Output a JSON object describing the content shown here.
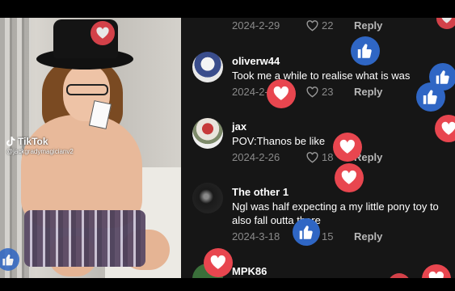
{
  "video": {
    "platform": "TikTok",
    "username": "@jackgradymagicianv2"
  },
  "comments": [
    {
      "name": "",
      "text": "",
      "date": "2024-2-29",
      "likes": "22",
      "reply": "Reply"
    },
    {
      "name": "oliverw44",
      "text": "Took me a while to realise what is was",
      "date": "2024-2-29",
      "likes": "23",
      "reply": "Reply"
    },
    {
      "name": "jax",
      "text": "POV:Thanos be like",
      "date": "2024-2-26",
      "likes": "18",
      "reply": "Reply"
    },
    {
      "name": "The other 1",
      "text": "Ngl was half expecting a my little pony toy to also fall outta there",
      "date": "2024-3-18",
      "likes": "15",
      "reply": "Reply"
    },
    {
      "name": "MPK86",
      "text": "",
      "date": "",
      "likes": "",
      "reply": ""
    }
  ],
  "colors": {
    "heart_reaction": "#e8464f",
    "like_reaction": "#2f66c4",
    "panel_bg": "#161616",
    "meta_text": "#8a8a8a"
  },
  "icons": [
    "tiktok-icon",
    "heart-outline-icon",
    "heart-reaction-icon",
    "thumbs-up-reaction-icon"
  ]
}
